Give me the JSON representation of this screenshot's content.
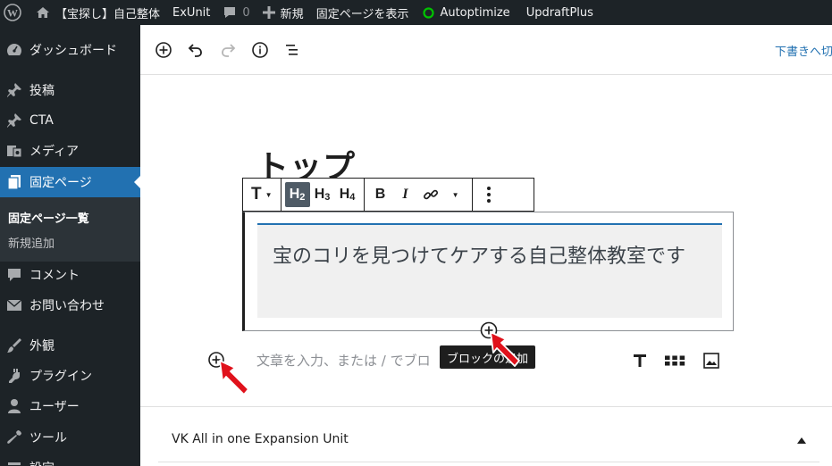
{
  "admin_bar": {
    "site_name": "【宝探し】自己整体",
    "exunit": "ExUnit",
    "comments_count": "0",
    "new_label": "新規",
    "view_page": "固定ページを表示",
    "autoptimize": "Autoptimize",
    "updraftplus": "UpdraftPlus"
  },
  "sidebar": {
    "items": [
      {
        "label": "ダッシュボード",
        "icon": "dashboard-icon"
      },
      {
        "label": "投稿",
        "icon": "pin-icon"
      },
      {
        "label": "CTA",
        "icon": "pin-icon"
      },
      {
        "label": "メディア",
        "icon": "media-icon"
      },
      {
        "label": "固定ページ",
        "icon": "page-icon",
        "current": true
      },
      {
        "label": "コメント",
        "icon": "comment-icon"
      },
      {
        "label": "お問い合わせ",
        "icon": "mail-icon"
      },
      {
        "label": "外観",
        "icon": "brush-icon"
      },
      {
        "label": "プラグイン",
        "icon": "plugin-icon"
      },
      {
        "label": "ユーザー",
        "icon": "user-icon"
      },
      {
        "label": "ツール",
        "icon": "wrench-icon"
      },
      {
        "label": "設定",
        "icon": "settings-icon"
      }
    ],
    "submenu": [
      {
        "label": "固定ページ一覧",
        "current": true
      },
      {
        "label": "新規追加"
      }
    ]
  },
  "editor_header": {
    "save_draft": "下書きへ切"
  },
  "content": {
    "page_title": "トップ",
    "cover_text": "宝のコリを見つけてケアする自己整体教室です",
    "placeholder": "文章を入力、または / でブロ",
    "tooltip": "ブロックの追加"
  },
  "block_toolbar": {
    "paragraph": "T",
    "h2": "H",
    "h2_sub": "2",
    "h3": "H",
    "h3_sub": "3",
    "h4": "H",
    "h4_sub": "4",
    "bold": "B",
    "italic": "I"
  },
  "metabox": {
    "title": "VK All in one Expansion Unit"
  },
  "colors": {
    "admin_dark": "#1d2327",
    "accent_blue": "#2271b1",
    "arrow_red": "#e0111b"
  }
}
